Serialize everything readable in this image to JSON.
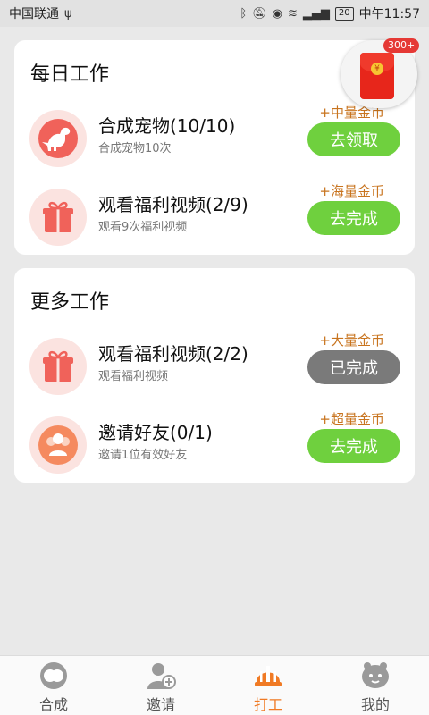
{
  "status_bar": {
    "carrier": "中国联通",
    "battery": "20",
    "time": "中午11:57"
  },
  "daily_section": {
    "title": "每日工作",
    "tasks": [
      {
        "name": "合成宠物(10/10)",
        "desc": "合成宠物10次",
        "reward": "+中量金币",
        "button": "去领取",
        "state": "claim",
        "icon": "dinosaur-icon"
      },
      {
        "name": "观看福利视频(2/9)",
        "desc": "观看9次福利视频",
        "reward": "+海量金币",
        "button": "去完成",
        "state": "todo",
        "icon": "gift-icon"
      }
    ]
  },
  "more_section": {
    "title": "更多工作",
    "tasks": [
      {
        "name": "观看福利视频(2/2)",
        "desc": "观看福利视频",
        "reward": "+大量金币",
        "button": "已完成",
        "state": "done",
        "icon": "gift-icon"
      },
      {
        "name": "邀请好友(0/1)",
        "desc": "邀请1位有效好友",
        "reward": "+超量金币",
        "button": "去完成",
        "state": "todo",
        "icon": "friends-icon"
      }
    ]
  },
  "floating_red_envelope": {
    "badge": "300+",
    "coin_symbol": "¥",
    "icon": "red-envelope-icon"
  },
  "bottom_nav": [
    {
      "label": "合成",
      "icon": "merge-icon",
      "active": false
    },
    {
      "label": "邀请",
      "icon": "invite-icon",
      "active": false
    },
    {
      "label": "打工",
      "icon": "hardhat-icon",
      "active": true
    },
    {
      "label": "我的",
      "icon": "profile-icon",
      "active": false
    }
  ],
  "colors": {
    "accent_green": "#6fd03e",
    "done_gray": "#7a7a7a",
    "reward_orange": "#c8741f",
    "active_tab": "#f07a24",
    "icon_bg": "#fbe3e0",
    "icon_red": "#f0625a"
  }
}
